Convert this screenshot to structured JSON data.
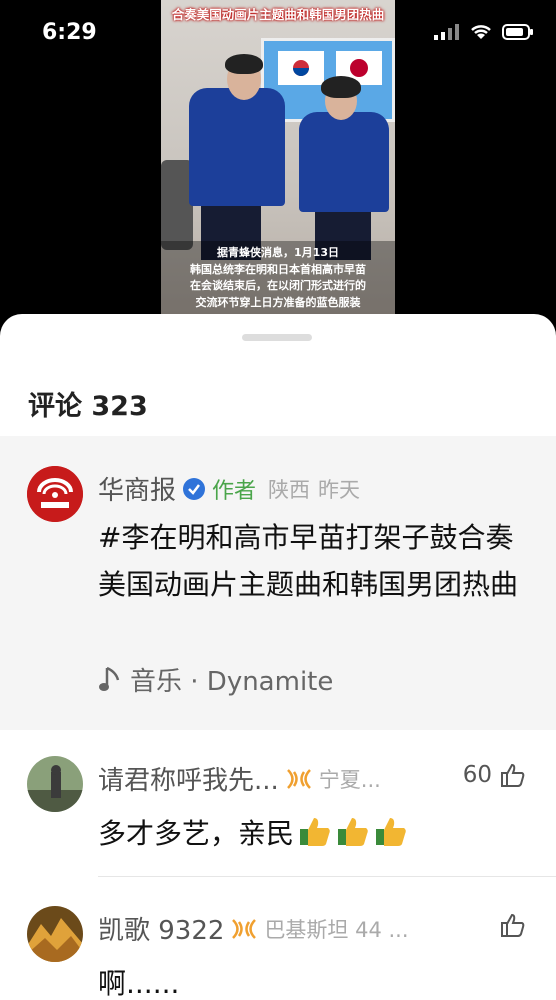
{
  "status_bar": {
    "time": "6:29"
  },
  "video": {
    "title": "合奏美国动画片主题曲和韩国男团热曲",
    "caption_lines": [
      "据青蜂侠消息，1月13日",
      "韩国总统李在明和日本首相高市早苗",
      "在会谈结束后，在以闭门形式进行的",
      "交流环节穿上日方准备的蓝色服装"
    ]
  },
  "comments": {
    "title": "评论 323",
    "author_comment": {
      "name": "华商报",
      "tag": "作者",
      "location": "陕西",
      "time": "昨天",
      "text": "#李在明和高市早苗打架子鼓合奏美国动画片主题曲和韩国男团热曲",
      "music_label": "音乐 · Dynamite"
    },
    "items": [
      {
        "name": "请君称呼我先...",
        "location": "宁夏...",
        "likes": "60",
        "text": "多才多艺，亲民"
      },
      {
        "name": "凯歌 9322",
        "location": "巴基斯坦 44 ...",
        "likes": "",
        "text": "啊......"
      }
    ]
  },
  "colors": {
    "accent_green": "#4aa54a",
    "verify_blue": "#2f73d9",
    "badge_orange": "#f0a030",
    "brand_red": "#c71b1b"
  },
  "icons": [
    "signal-icon",
    "wifi-icon",
    "battery-icon",
    "verified-icon",
    "music-note-icon",
    "vip-badge-icon",
    "thumbs-up-icon"
  ]
}
